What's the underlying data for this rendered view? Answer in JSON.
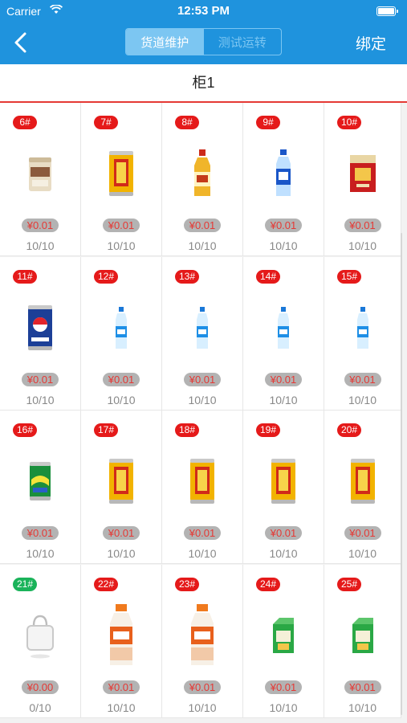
{
  "status": {
    "carrier": "Carrier",
    "time": "12:53 PM"
  },
  "nav": {
    "tabs": [
      "货道维护",
      "测试运转"
    ],
    "bind_label": "绑定"
  },
  "cabinet": {
    "title": "柜1"
  },
  "slots": [
    {
      "number": "6#",
      "price": "¥0.01",
      "stock": "10/10",
      "product": "milk-tea-cup"
    },
    {
      "number": "7#",
      "price": "¥0.01",
      "stock": "10/10",
      "product": "herbal-tea-can"
    },
    {
      "number": "8#",
      "price": "¥0.01",
      "stock": "10/10",
      "product": "tea-bottle"
    },
    {
      "number": "9#",
      "price": "¥0.01",
      "stock": "10/10",
      "product": "sports-drink-bottle"
    },
    {
      "number": "10#",
      "price": "¥0.01",
      "stock": "10/10",
      "product": "cigarette-pack"
    },
    {
      "number": "11#",
      "price": "¥0.01",
      "stock": "10/10",
      "product": "cola-can"
    },
    {
      "number": "12#",
      "price": "¥0.01",
      "stock": "10/10",
      "product": "water-bottle"
    },
    {
      "number": "13#",
      "price": "¥0.01",
      "stock": "10/10",
      "product": "water-bottle"
    },
    {
      "number": "14#",
      "price": "¥0.01",
      "stock": "10/10",
      "product": "water-bottle"
    },
    {
      "number": "15#",
      "price": "¥0.01",
      "stock": "10/10",
      "product": "water-bottle"
    },
    {
      "number": "16#",
      "price": "¥0.01",
      "stock": "10/10",
      "product": "soda-can"
    },
    {
      "number": "17#",
      "price": "¥0.01",
      "stock": "10/10",
      "product": "herbal-tea-can"
    },
    {
      "number": "18#",
      "price": "¥0.01",
      "stock": "10/10",
      "product": "herbal-tea-can"
    },
    {
      "number": "19#",
      "price": "¥0.01",
      "stock": "10/10",
      "product": "herbal-tea-can"
    },
    {
      "number": "20#",
      "price": "¥0.01",
      "stock": "10/10",
      "product": "herbal-tea-can"
    },
    {
      "number": "21#",
      "price": "¥0.00",
      "stock": "0/10",
      "product": "empty-bag",
      "badge_color": "green"
    },
    {
      "number": "22#",
      "price": "¥0.01",
      "stock": "10/10",
      "product": "yogurt-bottle"
    },
    {
      "number": "23#",
      "price": "¥0.01",
      "stock": "10/10",
      "product": "yogurt-bottle"
    },
    {
      "number": "24#",
      "price": "¥0.01",
      "stock": "10/10",
      "product": "juice-box"
    },
    {
      "number": "25#",
      "price": "¥0.01",
      "stock": "10/10",
      "product": "juice-box"
    }
  ],
  "colors": {
    "header": "#1f93dd",
    "badge": "#e51a1a",
    "badge_empty": "#1ab35a",
    "divider": "#e53935"
  }
}
